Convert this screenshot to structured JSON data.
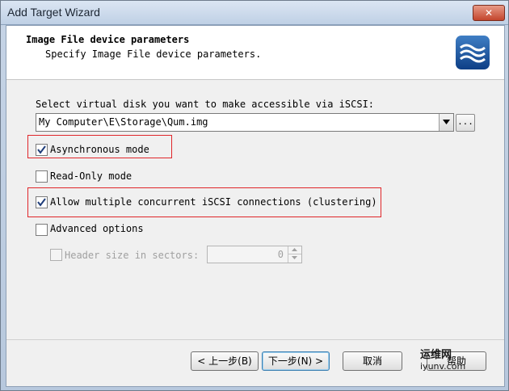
{
  "window": {
    "title": "Add Target Wizard",
    "close_glyph": "✕"
  },
  "header": {
    "title": "Image File device parameters",
    "subtitle": "Specify Image File device parameters.",
    "icon": "waves-logo-icon"
  },
  "disk": {
    "label": "Select virtual disk you want to make accessible via iSCSI:",
    "value": "My Computer\\E\\Storage\\Qum.img",
    "browse_label": "..."
  },
  "options": {
    "async": {
      "label": "Asynchronous mode",
      "checked": true
    },
    "readonly": {
      "label": "Read-Only mode",
      "checked": false
    },
    "multiple": {
      "label": "Allow multiple concurrent iSCSI connections (clustering)",
      "checked": true
    },
    "advanced": {
      "label": "Advanced options",
      "checked": false
    },
    "header_size": {
      "label": "Header size in sectors:",
      "checked": false,
      "value": "0"
    }
  },
  "buttons": {
    "back": "< 上一步(B)",
    "next": "下一步(N) >",
    "cancel": "取消",
    "help": "帮助"
  },
  "watermark": {
    "line1": "运维网",
    "line2": "iyunv.com"
  },
  "colors": {
    "highlight": "#e0262a",
    "accent": "#3c7fb1"
  }
}
